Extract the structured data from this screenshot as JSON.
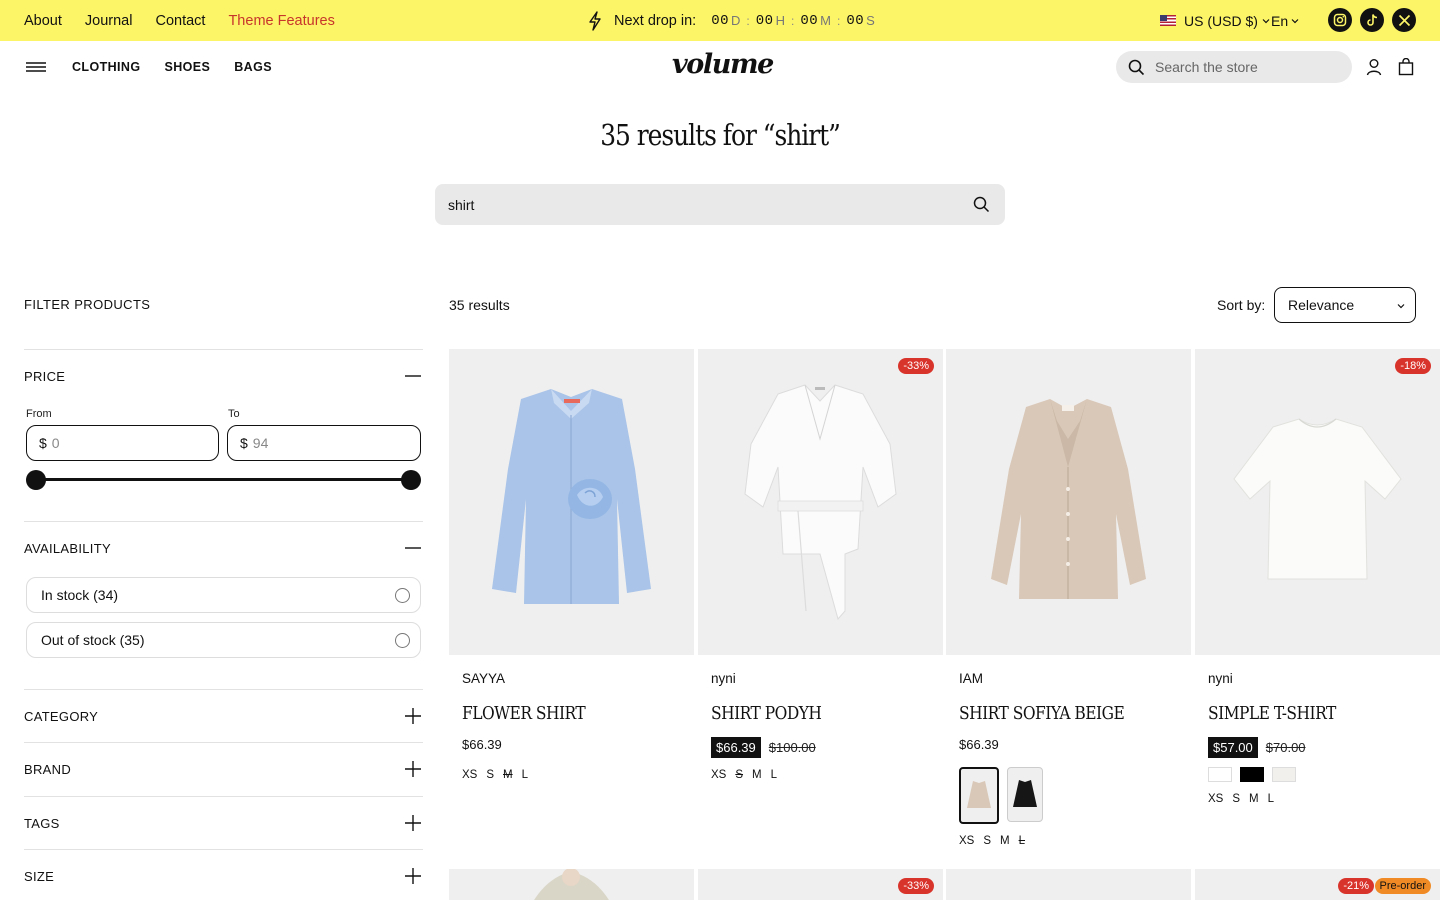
{
  "announcement": {
    "links": [
      "About",
      "Journal",
      "Contact",
      "Theme Features"
    ],
    "countdown_label": "Next drop in:",
    "countdown": [
      {
        "value": "00",
        "unit": "D"
      },
      {
        "value": "00",
        "unit": "H"
      },
      {
        "value": "00",
        "unit": "M"
      },
      {
        "value": "00",
        "unit": "S"
      }
    ],
    "currency": "US (USD $)",
    "language": "En",
    "socials": [
      "instagram-icon",
      "tiktok-icon",
      "x-icon"
    ]
  },
  "header": {
    "nav": [
      "CLOTHING",
      "SHOES",
      "BAGS"
    ],
    "logo": "volume",
    "search_placeholder": "Search the store"
  },
  "search": {
    "title": "35 results for “shirt”",
    "query": "shirt"
  },
  "filters": {
    "heading": "FILTER PRODUCTS",
    "price": {
      "title": "PRICE",
      "from_label": "From",
      "to_label": "To",
      "currency": "$",
      "from_value": "0",
      "to_value": "94"
    },
    "availability": {
      "title": "AVAILABILITY",
      "options": [
        "In stock (34)",
        "Out of stock (35)"
      ]
    },
    "collapsed": [
      "CATEGORY",
      "BRAND",
      "TAGS",
      "SIZE"
    ]
  },
  "results": {
    "count": "35 results",
    "sort_label": "Sort by:",
    "sort_value": "Relevance"
  },
  "products": [
    {
      "brand": "SAYYA",
      "name": "FLOWER SHIRT",
      "price": "$66.39",
      "compare": "",
      "badge": "",
      "sizes": [
        "XS",
        "S",
        "M",
        "L"
      ],
      "sizes_out": [
        "M"
      ]
    },
    {
      "brand": "nyni",
      "name": "SHIRT PODYH",
      "price": "$66.39",
      "compare": "$100.00",
      "badge": "-33%",
      "sizes": [
        "XS",
        "S",
        "M",
        "L"
      ],
      "sizes_out": [
        "S"
      ]
    },
    {
      "brand": "IAM",
      "name": "SHIRT SOFIYA BEIGE",
      "price": "$66.39",
      "compare": "",
      "badge": "",
      "sizes": [
        "XS",
        "S",
        "M",
        "L"
      ],
      "sizes_out": [
        "L"
      ]
    },
    {
      "brand": "nyni",
      "name": "SIMPLE T-SHIRT",
      "price": "$57.00",
      "compare": "$70.00",
      "badge": "-18%",
      "sizes": [
        "XS",
        "S",
        "M",
        "L"
      ],
      "sizes_out": []
    }
  ],
  "row2_badges": {
    "second": "-33%",
    "fourth_sale": "-21%",
    "fourth_pre": "Pre-order"
  },
  "colors": {
    "announcement_bg": "#fdf568",
    "accent_link": "#c7362b",
    "sale_badge": "#d9342b",
    "preorder_badge": "#f08a24",
    "search_bg": "#e9e9e9"
  }
}
